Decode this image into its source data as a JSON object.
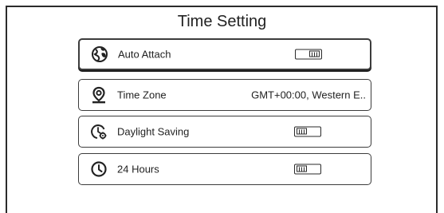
{
  "title": "Time Setting",
  "settings": [
    {
      "icon": "globe-icon",
      "label": "Auto Attach",
      "type": "toggle",
      "state": "on",
      "focused": true
    },
    {
      "icon": "location-pin-icon",
      "label": "Time Zone",
      "type": "value",
      "value": "GMT+00:00, Western E.."
    },
    {
      "icon": "clock-settings-icon",
      "label": "Daylight Saving",
      "type": "toggle",
      "state": "off"
    },
    {
      "icon": "clock-icon",
      "label": "24 Hours",
      "type": "toggle",
      "state": "off"
    }
  ]
}
